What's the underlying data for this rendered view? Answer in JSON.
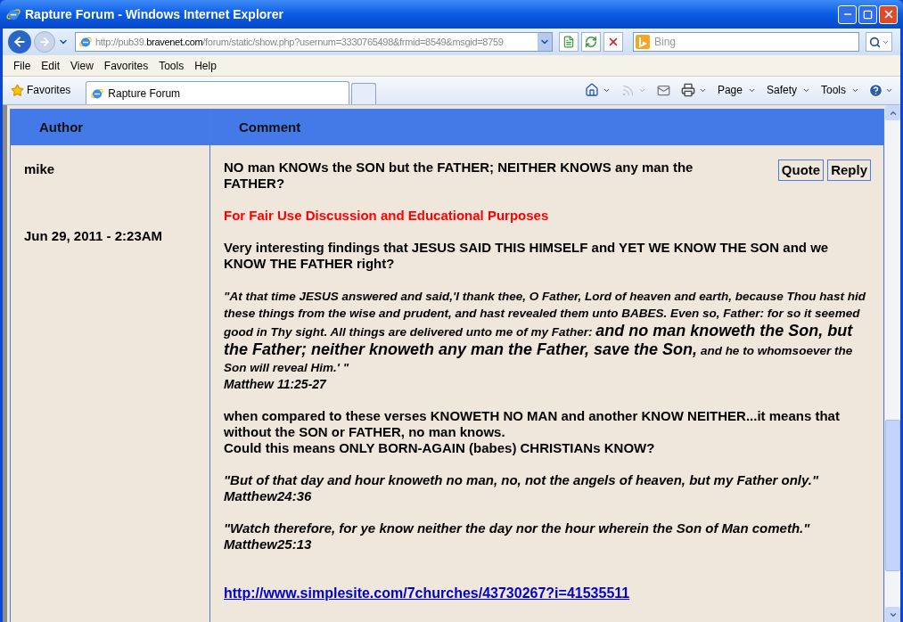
{
  "window": {
    "title": "Rapture Forum - Windows Internet Explorer"
  },
  "address_bar": {
    "url": {
      "prefix": "http://pub39.",
      "domain": "bravenet.com",
      "path": "/forum/static/show.php?usernum=3330765498&frmid=8549&msgid=8759"
    }
  },
  "search": {
    "placeholder": "Bing"
  },
  "menu": [
    "File",
    "Edit",
    "View",
    "Favorites",
    "Tools",
    "Help"
  ],
  "favorites_bar": {
    "favorites": "Favorites",
    "tabs": [
      {
        "label": "Rapture Forum",
        "selected": true
      }
    ]
  },
  "command_bar": {
    "feeds_disabled": true,
    "menus": [
      "Page",
      "Safety",
      "Tools"
    ]
  },
  "forum": {
    "columns": [
      "Author",
      "Comment"
    ],
    "post": {
      "author": "mike",
      "date": "Jun 29, 2011 - 2:23AM",
      "actions": [
        "Quote",
        "Reply"
      ],
      "blocks": [
        {
          "kind": "title",
          "lines": [
            "NO man KNOWs the SON but the FATHER; NEITHER KNOWS any man the FATHER?"
          ]
        },
        {
          "kind": "notice",
          "lines": [
            "For Fair Use Discussion and Educational Purposes"
          ]
        },
        {
          "kind": "text",
          "lines": [
            "Very interesting findings that JESUS SAID THIS HIMSELF and YET WE KNOW THE SON and we KNOW THE FATHER right?"
          ]
        },
        {
          "kind": "quote",
          "segments": [
            {
              "large": false,
              "text": "\"At that time JESUS answered and said,'I thank thee, O Father, Lord of heaven and earth, because Thou hast hid these things from the wise and prudent, and hast revealed them unto BABES. Even so, Father: for so it seemed good in Thy sight. All things are delivered unto me of my Father: "
            },
            {
              "large": true,
              "text": "and no man knoweth the Son, but the Father; neither knoweth any man the Father, save the Son,"
            },
            {
              "large": false,
              "text": " and he to whomsoever the Son will reveal Him.' \""
            }
          ],
          "reference": "Matthew 11:25-27"
        },
        {
          "kind": "text",
          "lines": [
            "when compared to these verses KNOWETH NO MAN and another KNOW NEITHER...it means that without the SON or FATHER, no man knows.",
            "Could this means ONLY BORN-AGAIN (babes) CHRISTIANs KNOW?"
          ]
        },
        {
          "kind": "scripture",
          "lines": [
            "\"But of that day and hour knoweth no man, no, not the angels of heaven, but my Father only.\"",
            "Matthew24:36"
          ]
        },
        {
          "kind": "scripture",
          "lines": [
            "\"Watch therefore, for ye know neither the day nor the hour wherein the Son of Man cometh.\"",
            "Matthew25:13"
          ]
        },
        {
          "kind": "link",
          "lines": [
            "http://www.simplesite.com/7churches/43730267?i=41535511"
          ]
        }
      ]
    }
  }
}
